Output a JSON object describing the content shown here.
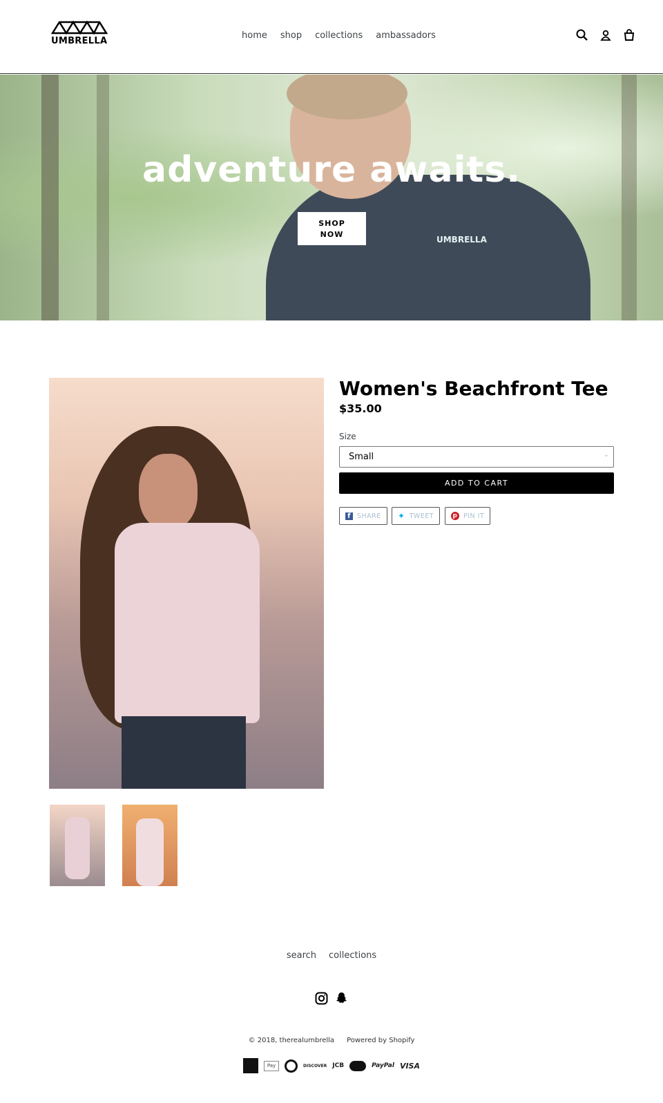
{
  "header": {
    "logo": "UMBRELLA",
    "nav": [
      "home",
      "shop",
      "collections",
      "ambassadors"
    ]
  },
  "hero": {
    "title": "adventure awaits.",
    "button_line1": "SHOP",
    "button_line2": "NOW",
    "shirt_logo": "UMBRELLA"
  },
  "product": {
    "title": "Women's Beachfront Tee",
    "price": "$35.00",
    "size_label": "Size",
    "size_value": "Small",
    "add_to_cart": "ADD TO CART",
    "share": [
      {
        "label": "SHARE",
        "icon": "facebook-icon",
        "color": "#3b5998"
      },
      {
        "label": "TWEET",
        "icon": "twitter-icon",
        "color": "#00aced"
      },
      {
        "label": "PIN IT",
        "icon": "pinterest-icon",
        "color": "#cb2027"
      }
    ]
  },
  "footer": {
    "links": [
      "search",
      "collections"
    ],
    "social": [
      "instagram-icon",
      "snapchat-icon"
    ],
    "copyright": "© 2018, therealumbrella",
    "powered": "Powered by Shopify",
    "payments": [
      "American Express",
      "Apple Pay",
      "Diners Club",
      "DISCOVER",
      "JCB",
      "MasterCard",
      "PayPal",
      "VISA"
    ]
  }
}
